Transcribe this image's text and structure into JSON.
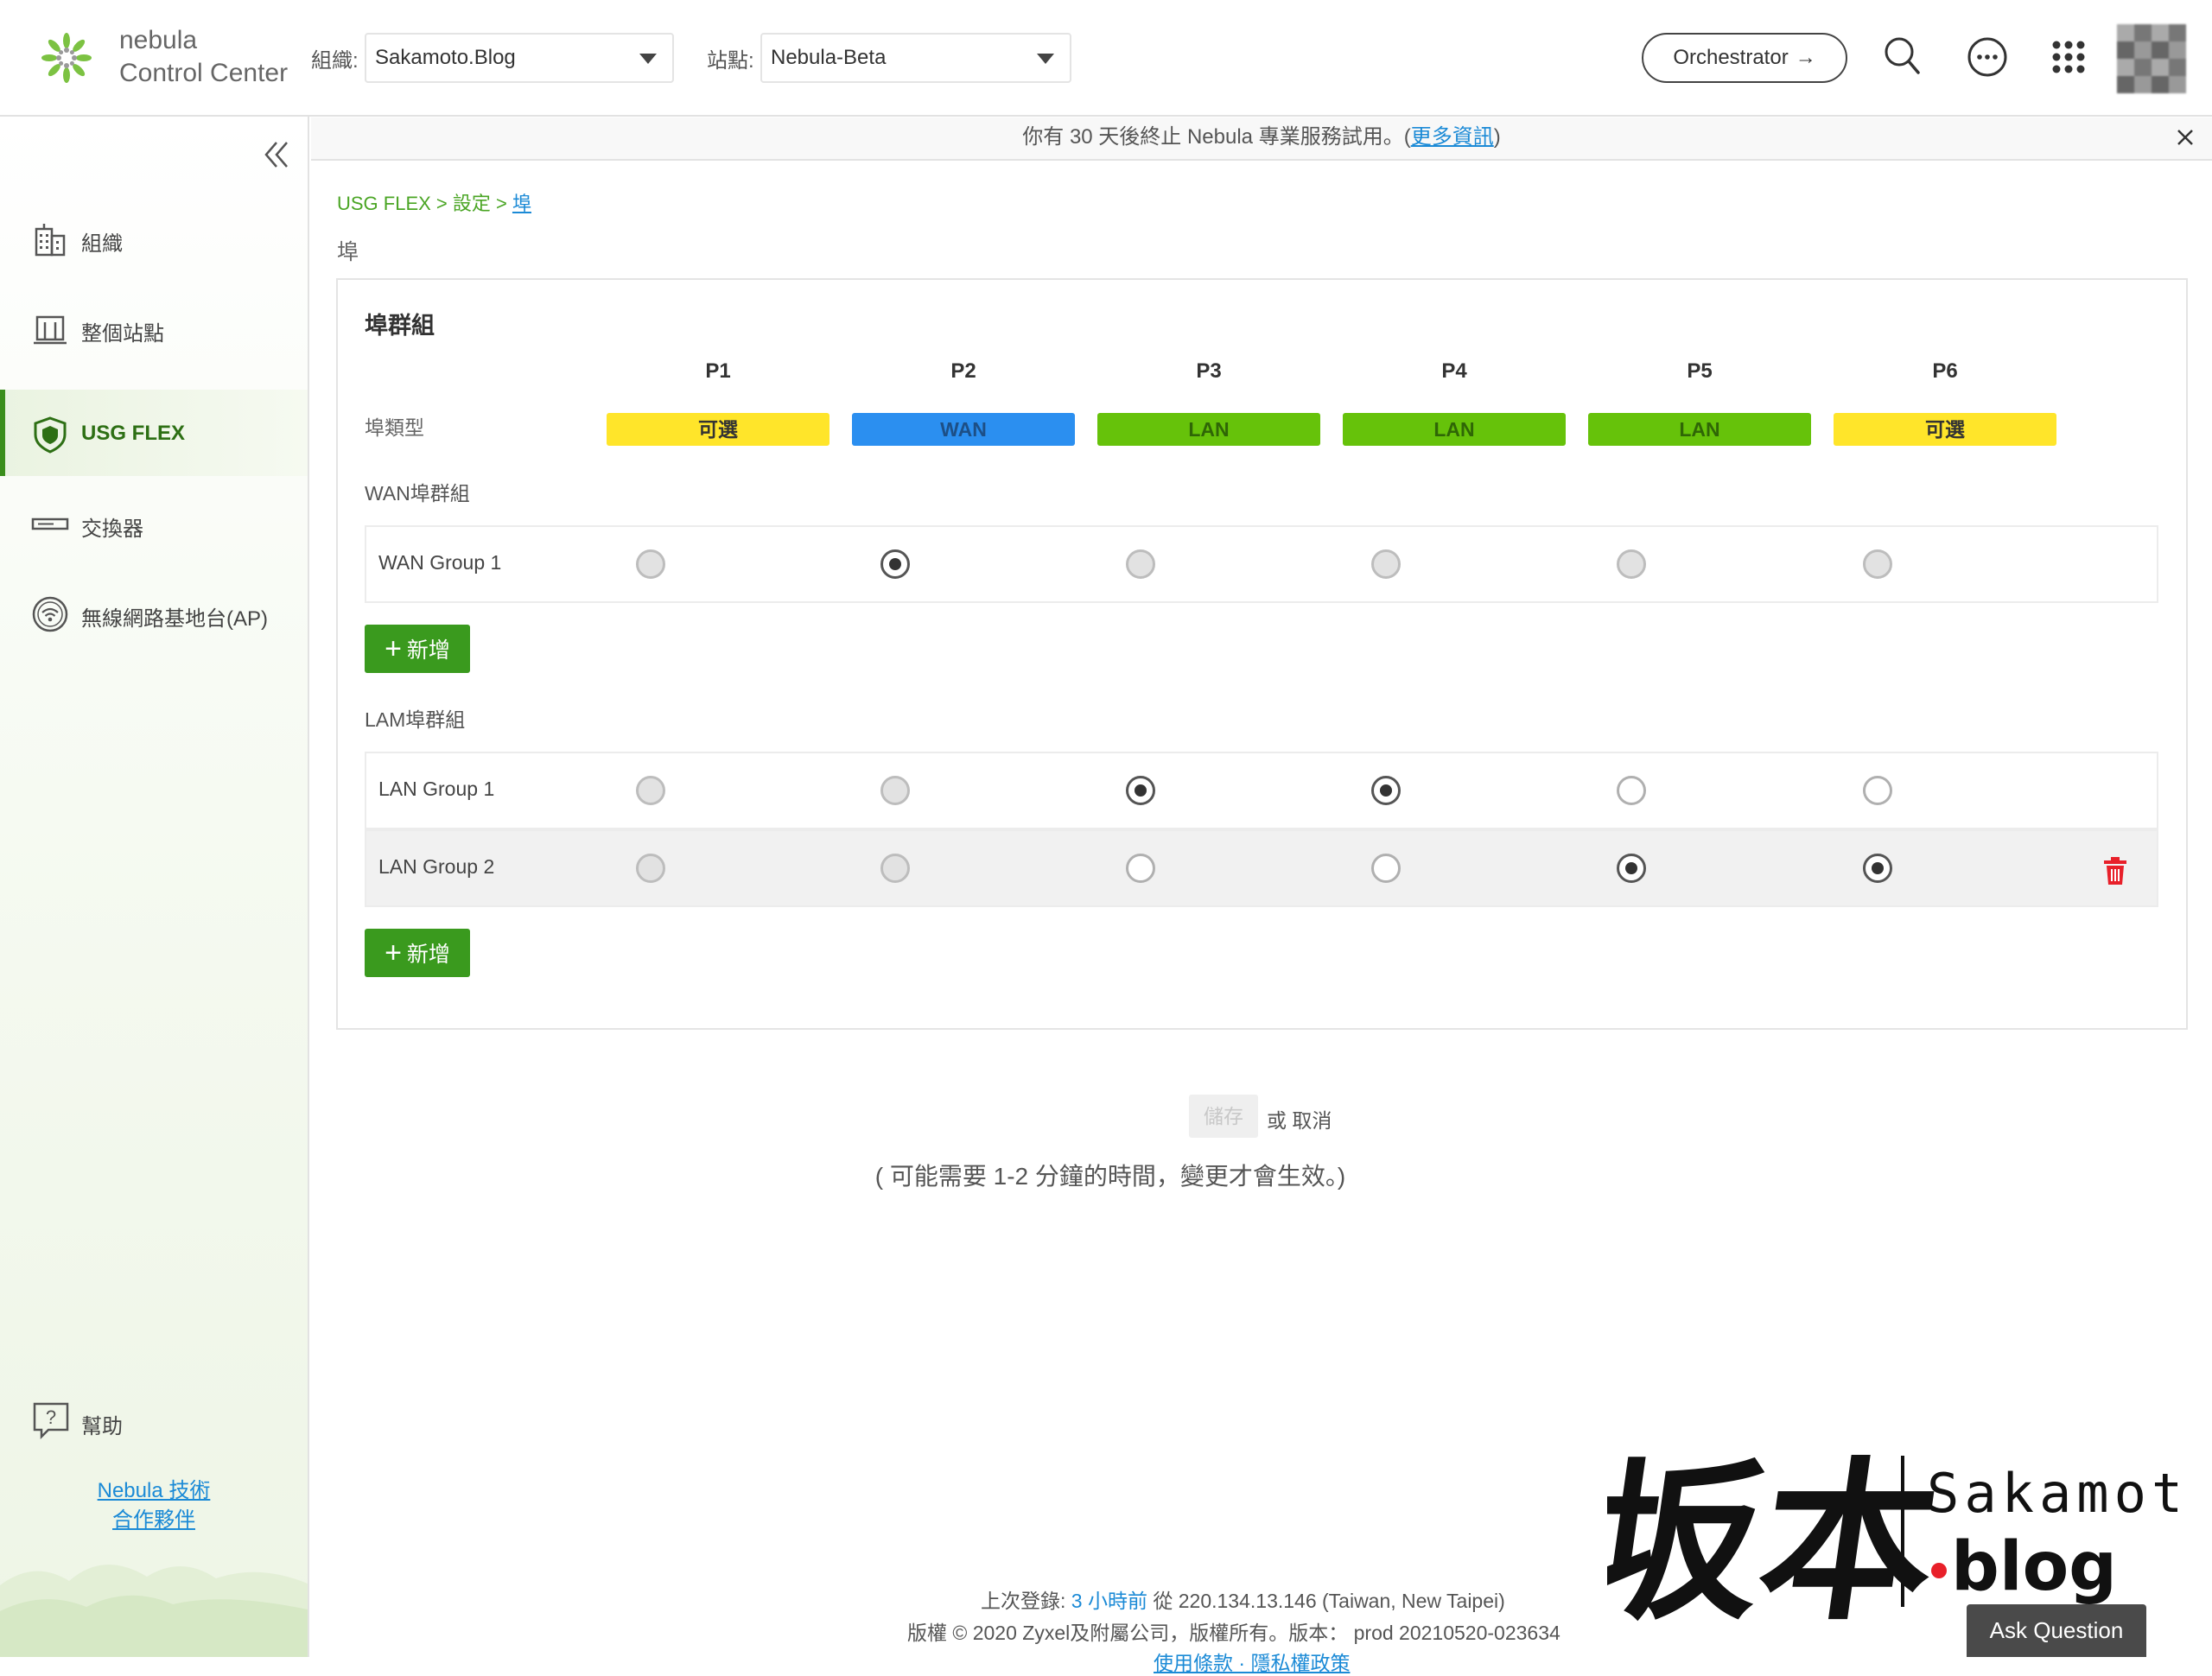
{
  "header": {
    "brand_line1": "nebula",
    "brand_line2": "Control Center",
    "org_label": "組織:",
    "org_value": "Sakamoto.Blog",
    "site_label": "站點:",
    "site_value": "Nebula-Beta",
    "orchestrator_label": "Orchestrator",
    "orchestrator_arrow": "→"
  },
  "sidebar": {
    "items": [
      {
        "label": "組織",
        "icon": "building-icon"
      },
      {
        "label": "整個站點",
        "icon": "site-icon"
      },
      {
        "label": "USG FLEX",
        "icon": "shield-icon",
        "active": true
      },
      {
        "label": "交換器",
        "icon": "switch-icon"
      },
      {
        "label": "無線網路基地台(AP)",
        "icon": "wifi-icon"
      }
    ],
    "help_label": "幫助",
    "partner_line1": "Nebula 技術",
    "partner_line2": "合作夥伴"
  },
  "notice": {
    "text": "你有 30 天後終止 Nebula 專業服務試用。(",
    "link": "更多資訊",
    "text_end": ")"
  },
  "breadcrumb": {
    "part1": "USG FLEX > 設定 > ",
    "current": "埠"
  },
  "page_title": "埠",
  "card": {
    "title": "埠群組",
    "port_type_label": "埠類型",
    "ports": [
      {
        "name": "P1",
        "type": "可選",
        "color": "#ffe52a",
        "text_color": "#333333"
      },
      {
        "name": "P2",
        "type": "WAN",
        "color": "#2b8ff0",
        "text_color": "#1d4f86"
      },
      {
        "name": "P3",
        "type": "LAN",
        "color": "#66c20a",
        "text_color": "#2f6606"
      },
      {
        "name": "P4",
        "type": "LAN",
        "color": "#66c20a",
        "text_color": "#2f6606"
      },
      {
        "name": "P5",
        "type": "LAN",
        "color": "#66c20a",
        "text_color": "#2f6606"
      },
      {
        "name": "P6",
        "type": "可選",
        "color": "#ffe52a",
        "text_color": "#333333"
      }
    ],
    "wan_section_label": "WAN埠群組",
    "wan_groups": [
      {
        "name": "WAN Group 1",
        "states": [
          "dis",
          "on",
          "dis",
          "dis",
          "dis",
          "dis"
        ]
      }
    ],
    "lan_section_label": "LAM埠群組",
    "lan_groups": [
      {
        "name": "LAN Group 1",
        "states": [
          "dis",
          "dis",
          "on",
          "on",
          "off",
          "off"
        ]
      },
      {
        "name": "LAN Group 2",
        "states": [
          "dis",
          "dis",
          "off",
          "off",
          "on",
          "on"
        ]
      }
    ],
    "add_label": "新增",
    "add_plus": "+"
  },
  "actions": {
    "save_label": "儲存",
    "or_cancel": "或 取消",
    "hint": "( 可能需要 1-2 分鐘的時間，變更才會生效。)"
  },
  "footer": {
    "last_login_prefix": "上次登錄: ",
    "last_login_ago": "3 小時前",
    "last_login_suffix": " 從 220.134.13.146 (Taiwan, New Taipei)",
    "copyright": "版權 © 2020 Zyxel及附屬公司，版權所有。版本： prod 20210520-023634",
    "links": "使用條款 · 隱私權政策"
  },
  "watermark": {
    "kanji": "坂本",
    "latin": "Sakamoto",
    "dot_blog": "blog"
  },
  "ask_question_label": "Ask Question",
  "colors": {
    "accent_green": "#3a9a1e",
    "link_blue": "#1b8ad6",
    "delete_red": "#e8202a"
  }
}
